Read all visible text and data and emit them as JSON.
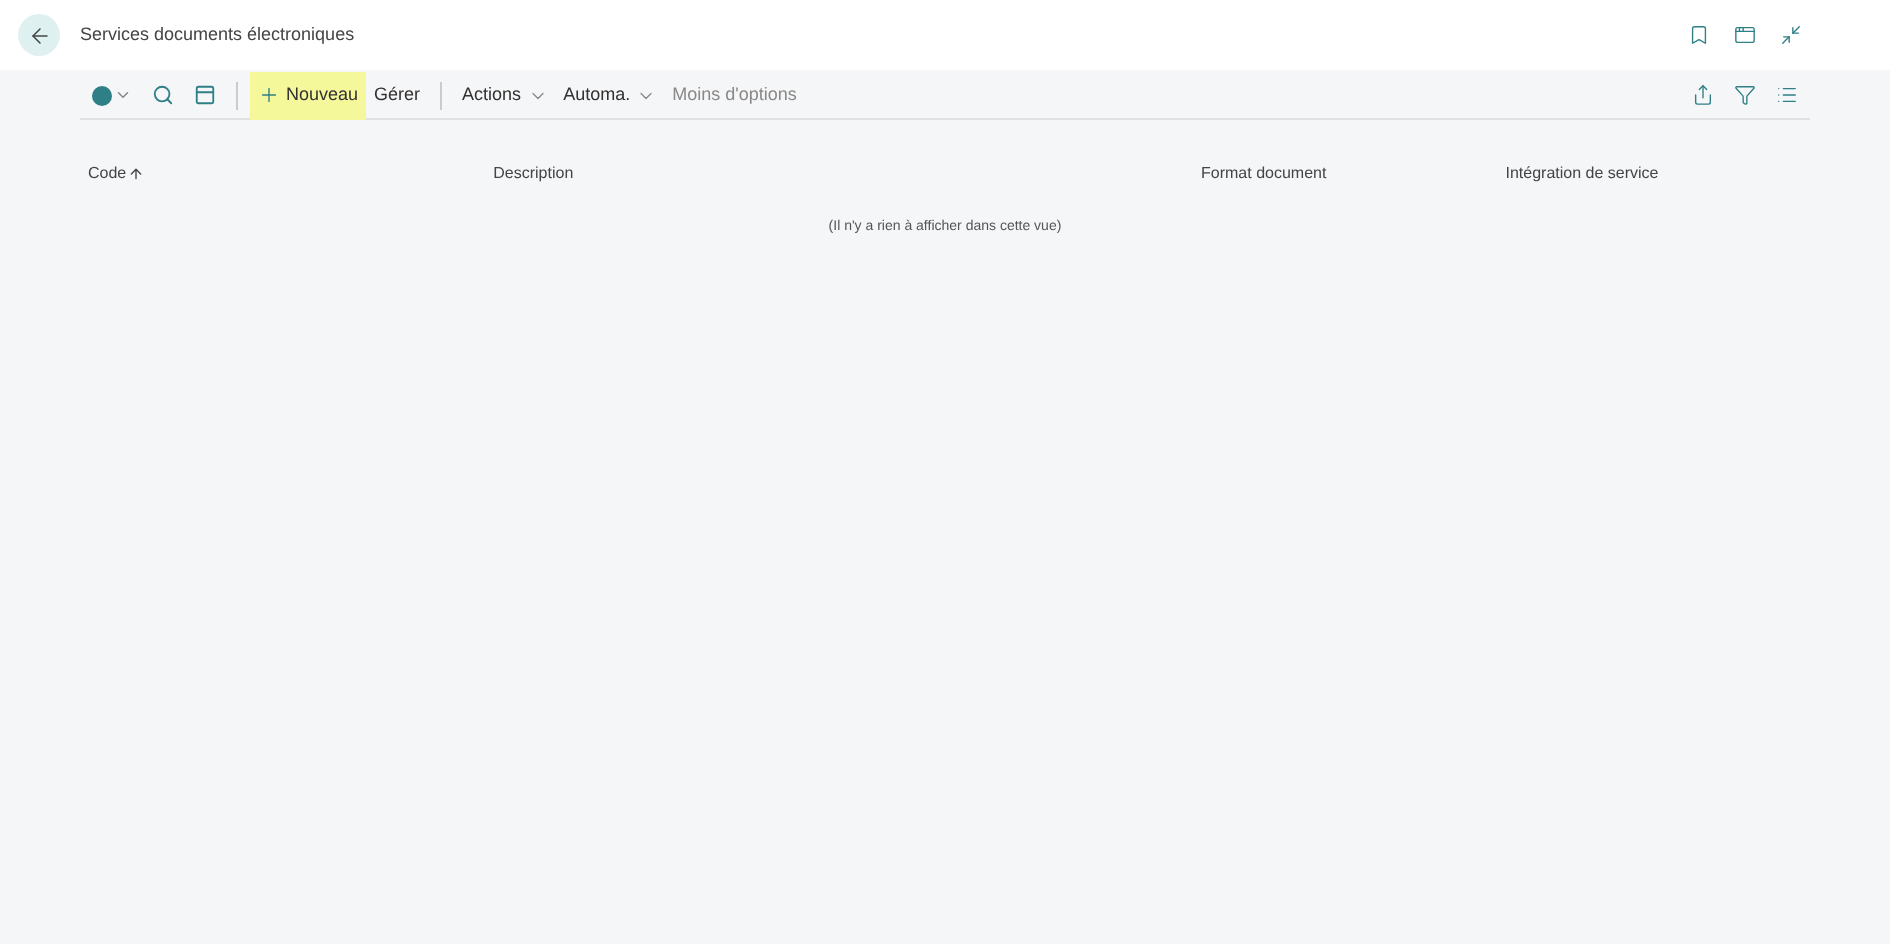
{
  "window": {
    "title": "Services documents électroniques"
  },
  "toolbar": {
    "items": [
      {
        "label": "Nouveau",
        "kind": "new",
        "highlighted": true
      },
      {
        "label": "Gérer",
        "kind": "plain",
        "highlighted": false
      },
      {
        "label": "Actions",
        "kind": "menu",
        "highlighted": false
      },
      {
        "label": "Automa.",
        "kind": "menu",
        "highlighted": false
      },
      {
        "label": "Moins d'options",
        "kind": "muted",
        "highlighted": false
      }
    ]
  },
  "table": {
    "columns": [
      {
        "label": "Code",
        "sorted": true
      },
      {
        "label": "Description",
        "sorted": false
      },
      {
        "label": "Format document",
        "sorted": false
      },
      {
        "label": "Intégration de service",
        "sorted": false
      }
    ],
    "empty_message": "(Il n'y a rien à afficher dans cette vue)"
  }
}
